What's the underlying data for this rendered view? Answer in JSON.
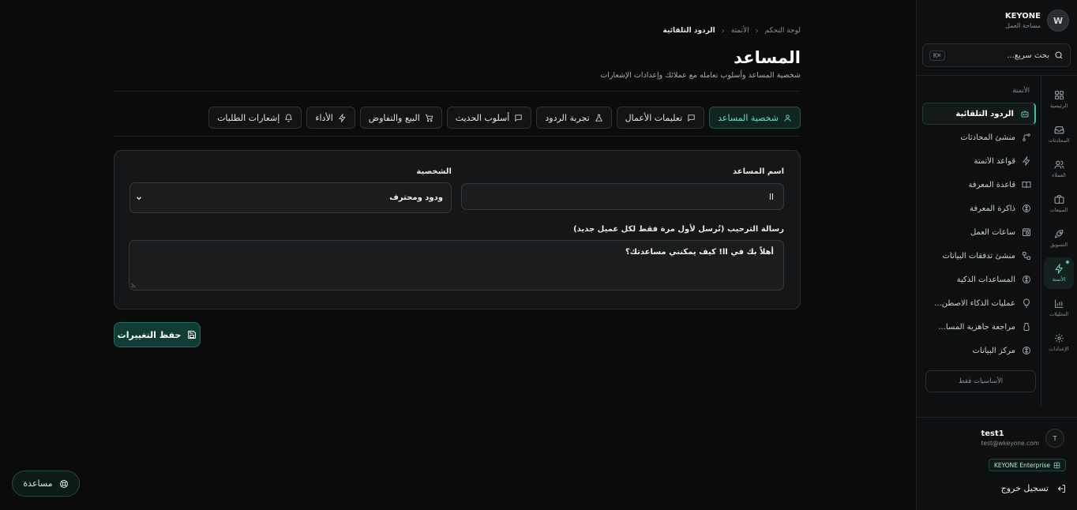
{
  "brand": {
    "name": "KEYONE",
    "subtitle": "مساحة العمل",
    "logo_letter": "W"
  },
  "search": {
    "placeholder": "بحث سريع...",
    "shortcut": "⌘K"
  },
  "rail": [
    {
      "label": "الرئيسية",
      "icon": "grid-icon"
    },
    {
      "label": "المحادثات",
      "icon": "inbox-icon"
    },
    {
      "label": "العملاء",
      "icon": "users-icon"
    },
    {
      "label": "المبيعات",
      "icon": "briefcase-icon"
    },
    {
      "label": "التسويق",
      "icon": "rocket-icon"
    },
    {
      "label": "الأتمتة",
      "icon": "bolt-icon",
      "active": true
    },
    {
      "label": "التحليلات",
      "icon": "bar-chart-icon"
    },
    {
      "label": "الإعدادات",
      "icon": "gear-icon"
    }
  ],
  "menu": {
    "section": "الأتمتة",
    "items": [
      {
        "label": "الردود التلقائية",
        "icon": "bot-icon",
        "active": true
      },
      {
        "label": "منشئ المحادثات",
        "icon": "flow-icon"
      },
      {
        "label": "قواعد الأتمتة",
        "icon": "bolt-icon"
      },
      {
        "label": "قاعدة المعرفة",
        "icon": "book-icon"
      },
      {
        "label": "ذاكرة المعرفة",
        "icon": "brain-icon"
      },
      {
        "label": "ساعات العمل",
        "icon": "calendar-clock-icon"
      },
      {
        "label": "منشئ تدفقات البيانات",
        "icon": "workflow-icon"
      },
      {
        "label": "المساعدات الذكية",
        "icon": "brain-icon"
      },
      {
        "label": "عمليات الذكاء الاصطن...",
        "icon": "lightbulb-icon"
      },
      {
        "label": "مراجعة جاهزية المسا...",
        "icon": "flask-icon"
      },
      {
        "label": "مركز البيانات",
        "icon": "brain-icon"
      }
    ],
    "basics_button": "الأساسيات فقط"
  },
  "user": {
    "initial": "T",
    "name": "test1",
    "email": "test@wkeyone.com",
    "plan": "KEYONE Enterprise"
  },
  "logout_label": "تسجيل خروج",
  "breadcrumb": [
    "لوحة التحكم",
    "الأتمتة",
    "الردود التلقائية"
  ],
  "page": {
    "title": "المساعد",
    "subtitle": "شخصية المساعد وأسلوب تعامله مع عملائك وإعدادات الإشعارات"
  },
  "tabs": [
    {
      "label": "شخصية المساعد",
      "icon": "user-icon",
      "active": true
    },
    {
      "label": "تعليمات الأعمال",
      "icon": "message-icon"
    },
    {
      "label": "تجربة الردود",
      "icon": "flask-icon"
    },
    {
      "label": "أسلوب الحديث",
      "icon": "message-icon"
    },
    {
      "label": "البيع والتفاوض",
      "icon": "cart-icon"
    },
    {
      "label": "الأداء",
      "icon": "bolt-icon"
    },
    {
      "label": "إشعارات الطلبات",
      "icon": "bell-icon"
    }
  ],
  "form": {
    "name_label": "اسم المساعد",
    "name_value": "ll",
    "persona_label": "الشخصية",
    "persona_value": "ودود ومحترف",
    "welcome_label": "رسالة الترحيب (تُرسل لأول مرة فقط لكل عميل جديد)",
    "welcome_value": "أهلاً بك في ll! كيف يمكنني مساعدتك؟"
  },
  "save_label": "حفظ التغييرات",
  "help_label": "مساعدة",
  "colors": {
    "accent": "#2fc49c",
    "background": "#0b0b0c",
    "card": "#151617"
  }
}
